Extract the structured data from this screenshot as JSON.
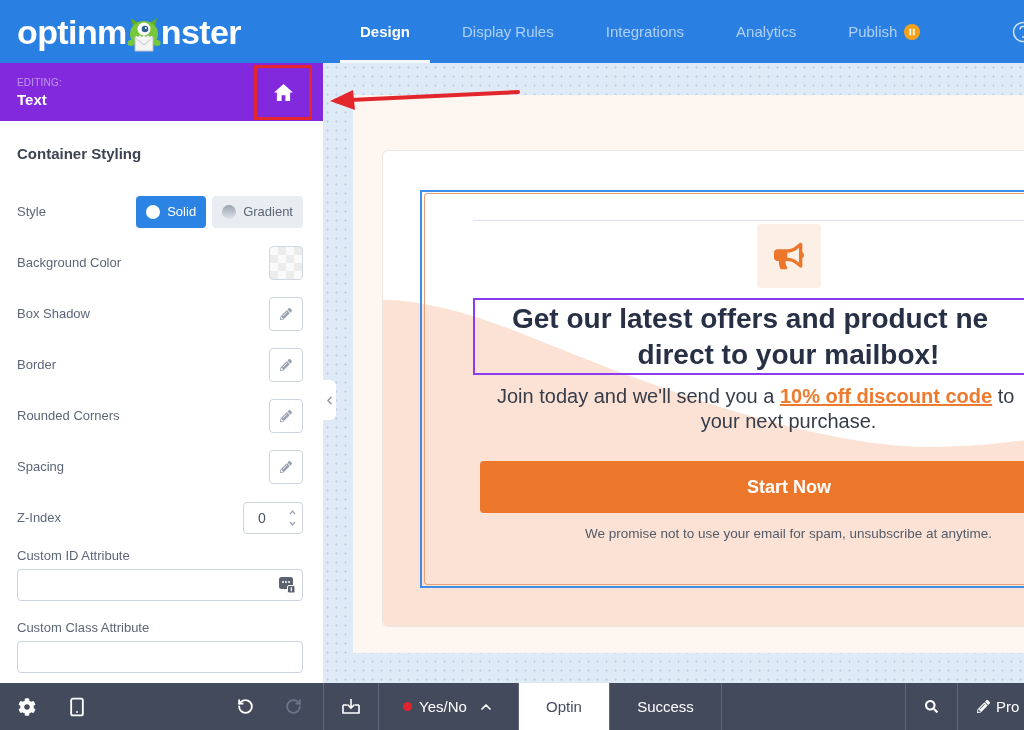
{
  "header": {
    "logo": {
      "before": "optinm",
      "after": "nster"
    },
    "tabs": [
      {
        "label": "Design",
        "selected": true,
        "paused": false
      },
      {
        "label": "Display Rules",
        "selected": false,
        "paused": false
      },
      {
        "label": "Integrations",
        "selected": false,
        "paused": false
      },
      {
        "label": "Analytics",
        "selected": false,
        "paused": false
      },
      {
        "label": "Publish",
        "selected": false,
        "paused": true
      }
    ]
  },
  "editing": {
    "caption": "EDITING:",
    "element": "Text",
    "home_button": {
      "highlighted": true
    }
  },
  "panel": {
    "title": "Container Styling",
    "rows": [
      {
        "kind": "segmented",
        "label": "Style",
        "options": [
          {
            "kind": "solid",
            "label": "Solid",
            "selected": true
          },
          {
            "kind": "gradient",
            "label": "Gradient",
            "selected": false
          }
        ]
      },
      {
        "kind": "swatch",
        "label": "Background Color"
      },
      {
        "kind": "edit",
        "label": "Box Shadow"
      },
      {
        "kind": "edit",
        "label": "Border"
      },
      {
        "kind": "edit",
        "label": "Rounded Corners"
      },
      {
        "kind": "edit",
        "label": "Spacing"
      },
      {
        "kind": "number",
        "label": "Z-Index",
        "value": "0"
      },
      {
        "kind": "field",
        "label": "Custom ID Attribute",
        "tag_icon": true
      },
      {
        "kind": "field",
        "label": "Custom Class Attribute",
        "tag_icon": false
      }
    ]
  },
  "preview": {
    "outlined": true,
    "headline": {
      "selected": true,
      "lines": [
        "Get our latest offers and product ne",
        "direct to your mailbox!"
      ]
    },
    "subtitle": {
      "before": "Join today and we'll send you a",
      "link": "10% off discount code",
      "after": "to",
      "line_2": "your next purchase."
    },
    "button": "Start Now",
    "disclaimer": "We promise not to use your email for spam, unsubscribe at anytime."
  },
  "bottom_bar": {
    "history": [
      {
        "kind": "undo",
        "disabled": false
      },
      {
        "kind": "redo",
        "disabled": true
      }
    ],
    "toggle": {
      "label": "Yes/No"
    },
    "views": [
      {
        "label": "Optin",
        "selected": true
      },
      {
        "label": "Success",
        "selected": false
      }
    ],
    "edit_label": "Pro"
  }
}
